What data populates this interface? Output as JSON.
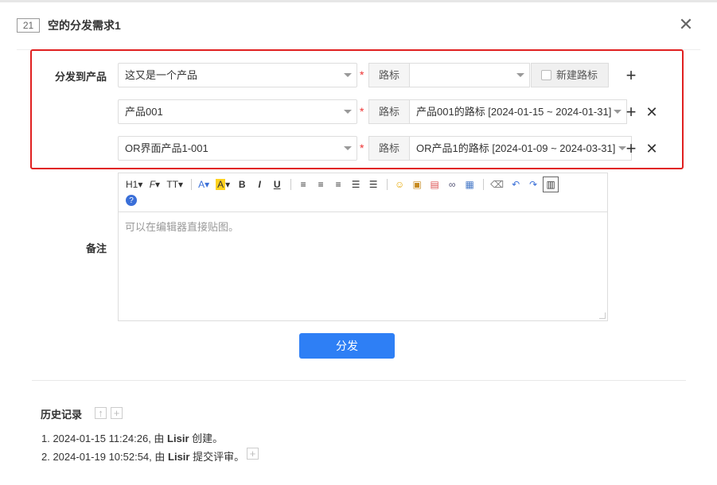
{
  "header": {
    "id": "21",
    "title": "空的分发需求1"
  },
  "form": {
    "distribute_label": "分发到产品",
    "branch_label": "路标",
    "new_branch_label": "新建路标",
    "rows": [
      {
        "product": "这又是一个产品",
        "branch": ""
      },
      {
        "product": "产品001",
        "branch": "产品001的路标 [2024-01-15 ~ 2024-01-31]"
      },
      {
        "product": "OR界面产品1-001",
        "branch": "OR产品1的路标 [2024-01-09 ~ 2024-03-31]"
      }
    ],
    "remark_label": "备注",
    "editor_placeholder": "可以在编辑器直接贴图。",
    "submit_label": "分发"
  },
  "toolbar": {
    "heading": "H1",
    "font_family": "F",
    "font_size": "TT",
    "font_color": "A",
    "bg_color": "A",
    "bold": "B",
    "italic": "I",
    "underline": "U"
  },
  "history": {
    "title": "历史记录",
    "items": [
      {
        "prefix": "1. 2024-01-15 11:24:26, 由 ",
        "user": "Lisir",
        "action": " 创建。"
      },
      {
        "prefix": "2. 2024-01-19 10:52:54, 由 ",
        "user": "Lisir",
        "action": " 提交评审。"
      }
    ]
  },
  "colors": {
    "primary": "#2e7ff5",
    "highlight": "#e02020",
    "required": "#e33333"
  }
}
